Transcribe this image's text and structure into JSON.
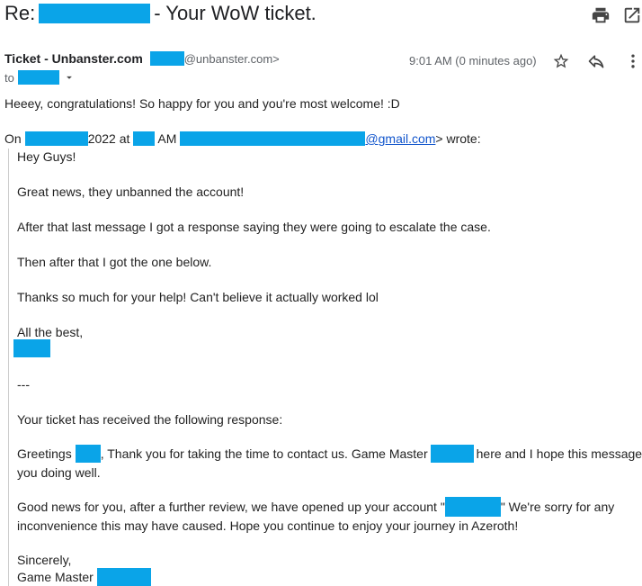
{
  "subject": {
    "prefix": "Re:",
    "suffix": "- Your WoW ticket."
  },
  "header": {
    "sender_name": "Ticket - Unbanster.com",
    "sender_email_domain": "@unbanster.com>",
    "to_label": "to",
    "time": "9:01 AM (0 minutes ago)"
  },
  "icons": {
    "print": "print-icon",
    "open_new_window": "open-in-new-icon",
    "star": "star-icon",
    "reply": "reply-icon",
    "more": "more-vert-icon",
    "dropdown": "caret-down-icon"
  },
  "body": {
    "reply": "Heeey, congratulations! So happy for you and you're most welcome! :D",
    "on_prefix": "On",
    "on_year": "2022 at",
    "on_am": "AM",
    "on_email": "@gmail.com",
    "on_wrote": "> wrote:",
    "quote": {
      "greeting": "Hey Guys!",
      "p1": "Great news, they unbanned the account!",
      "p2": "After that last message I got a response saying they were going to escalate the case.",
      "p3": "Then after that I got the one below.",
      "p4": "Thanks so much for your help! Can't believe it actually worked lol",
      "closing": "All the best,",
      "separator": "---",
      "p5": "Your ticket has received the following response:",
      "gm_greet_a": "Greetings",
      "gm_greet_b": ", Thank you for taking the time to contact us. Game Master",
      "gm_greet_c": "here and I hope this message finds",
      "gm_greet_d": "you doing well.",
      "gm_news_a": "Good news for you, after a further review, we have opened up your account \"",
      "gm_news_b": "\" We're sorry for any",
      "gm_news_c": "inconvenience this may have caused. Hope you continue to enjoy your journey in Azeroth!",
      "sincerely": "Sincerely,",
      "gm_sign": "Game Master"
    }
  },
  "colors": {
    "redaction": "#0aa4e8",
    "link": "#1155cc",
    "meta_gray": "#5f6368"
  }
}
